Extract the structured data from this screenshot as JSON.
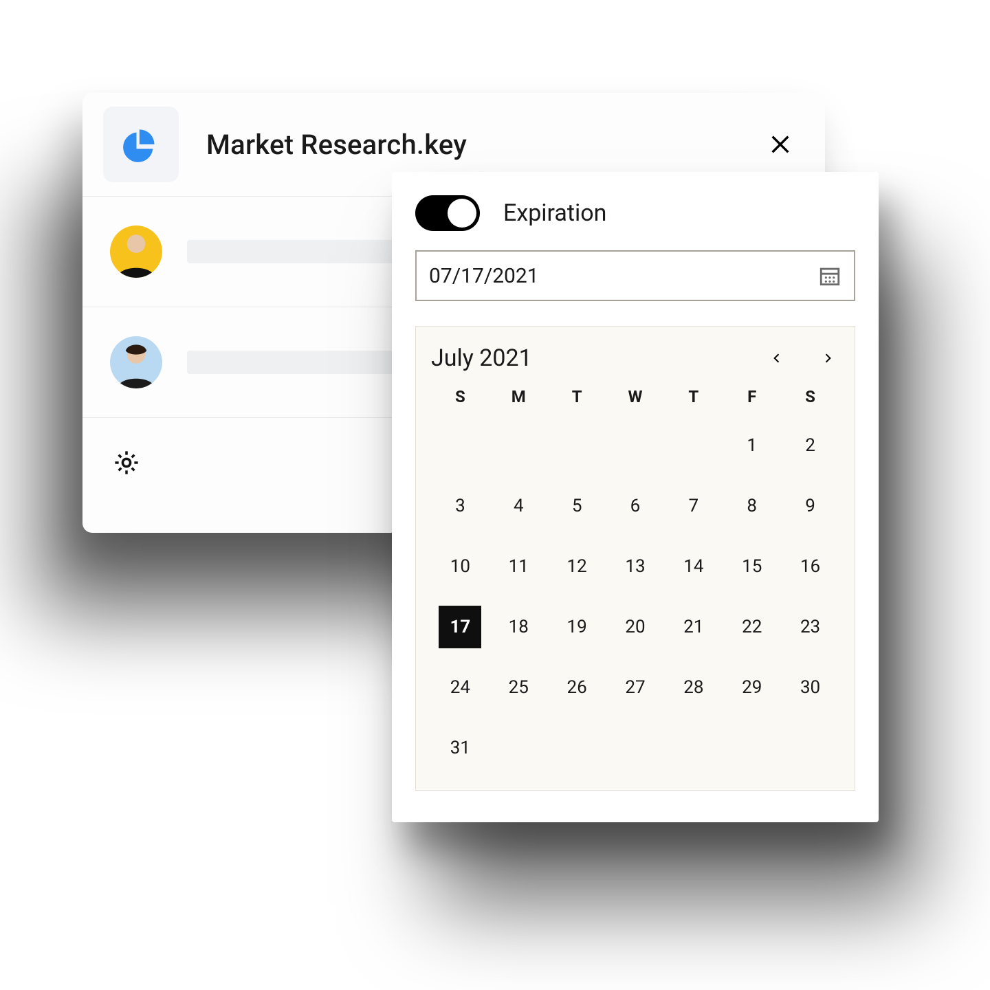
{
  "share": {
    "file_title": "Market Research.key",
    "users": [
      {
        "avatar_bg": "#f7c21c"
      },
      {
        "avatar_bg": "#b9d9f2"
      }
    ]
  },
  "expiration": {
    "label": "Expiration",
    "toggle_on": true,
    "date_value": "07/17/2021"
  },
  "calendar": {
    "title": "July 2021",
    "dow": [
      "S",
      "M",
      "T",
      "W",
      "T",
      "F",
      "S"
    ],
    "leading_blanks": 5,
    "days_in_month": 31,
    "selected_day": 17
  },
  "colors": {
    "accent_blue": "#2f8cf0",
    "selected_bg": "#0f0f0f",
    "calendar_bg": "#fbf9f4"
  }
}
